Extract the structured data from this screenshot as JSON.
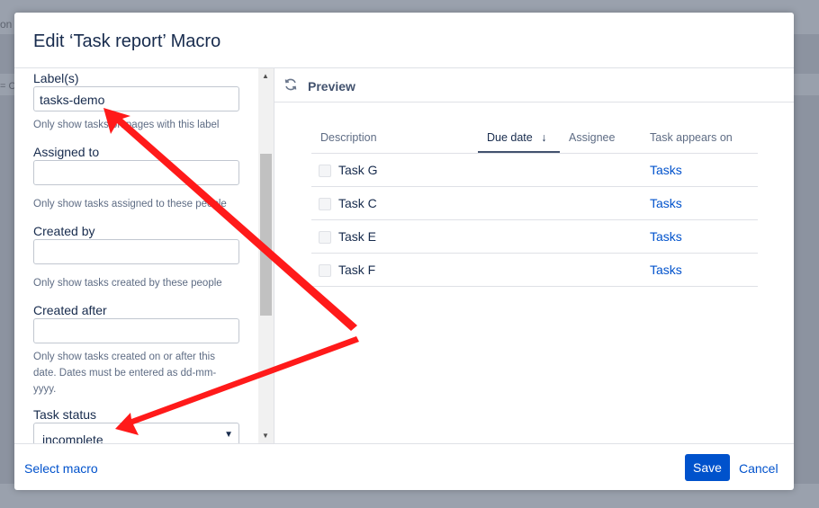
{
  "background": {
    "edge_text_top": "on",
    "edge_text_mid": "= C"
  },
  "modal": {
    "title": "Edit ‘Task report’ Macro"
  },
  "form": {
    "labels": {
      "label": "Label(s)",
      "value": "tasks-demo",
      "help": "Only show tasks on pages with this label"
    },
    "assigned_to": {
      "label": "Assigned to",
      "value": "",
      "help": "Only show tasks assigned to these people"
    },
    "created_by": {
      "label": "Created by",
      "value": "",
      "help": "Only show tasks created by these people"
    },
    "created_after": {
      "label": "Created after",
      "value": "",
      "help": "Only show tasks created on or after this date. Dates must be entered as dd-mm-yyyy."
    },
    "task_status": {
      "label": "Task status",
      "value": "incomplete"
    }
  },
  "preview": {
    "title": "Preview",
    "columns": [
      "Description",
      "Due date",
      "Assignee",
      "Task appears on"
    ],
    "sort_column": "Due date",
    "rows": [
      {
        "task": "Task G",
        "due": "",
        "assignee": "",
        "page": "Tasks"
      },
      {
        "task": "Task C",
        "due": "",
        "assignee": "",
        "page": "Tasks"
      },
      {
        "task": "Task E",
        "due": "",
        "assignee": "",
        "page": "Tasks"
      },
      {
        "task": "Task F",
        "due": "",
        "assignee": "",
        "page": "Tasks"
      }
    ]
  },
  "footer": {
    "select_macro": "Select macro",
    "save": "Save",
    "cancel": "Cancel"
  },
  "colors": {
    "primary": "#0052cc",
    "annotation": "#ff0000"
  },
  "icons": {
    "refresh": "refresh-icon",
    "sort": "arrow-down-icon",
    "caret": "caret-down-icon"
  }
}
